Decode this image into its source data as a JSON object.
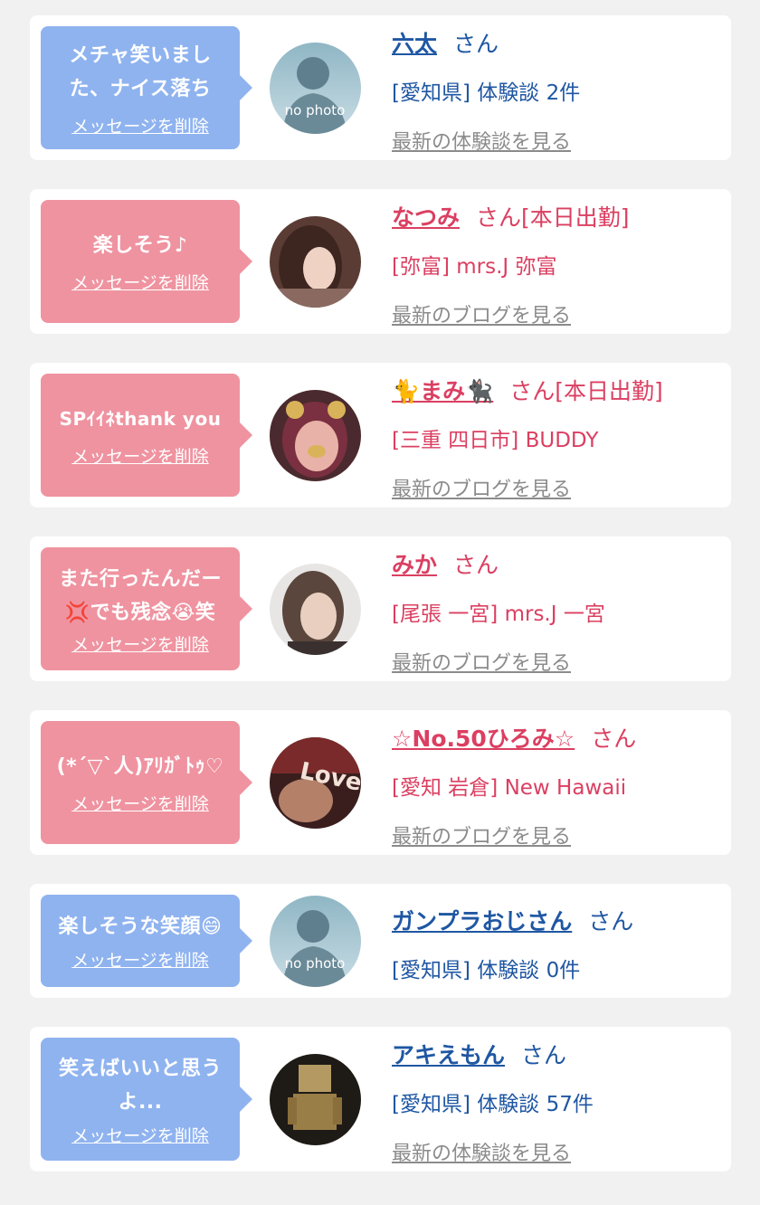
{
  "delete_label": "メッセージを削除",
  "colors": {
    "blue_bubble": "#8fb3ef",
    "pink_bubble": "#ef93a0",
    "blue_text": "#1f57a3",
    "pink_text": "#db3f61"
  },
  "items": [
    {
      "message": "メチャ笑いました、ナイス落ち",
      "name": "六太",
      "honorific": "さん",
      "location": "[愛知県]",
      "detail": "体験談 2件",
      "link": "最新の体験談を見る",
      "avatar": "no photo"
    },
    {
      "message": "楽しそう♪",
      "name": "なつみ",
      "honorific": "さん[本日出勤]",
      "location": "[弥富]",
      "detail": "mrs.J 弥富",
      "link": "最新のブログを見る"
    },
    {
      "message": "SPｲｲﾈthank you",
      "name": "🐈まみ🐈‍⬛",
      "honorific": "さん[本日出勤]",
      "location": "[三重 四日市]",
      "detail": "BUDDY",
      "link": "最新のブログを見る"
    },
    {
      "message": "また行ったんだー💢でも残念😭笑",
      "name": "みか",
      "honorific": "さん",
      "location": "[尾張 一宮]",
      "detail": "mrs.J 一宮",
      "link": "最新のブログを見る"
    },
    {
      "message": "(*´▽`人)ｱﾘｶﾞﾄｩ♡",
      "name": "☆No.50ひろみ☆",
      "honorific": "さん",
      "location": "[愛知 岩倉]",
      "detail": "New Hawaii",
      "link": "最新のブログを見る",
      "avatar_text": "Love"
    },
    {
      "message": "楽しそうな笑顔😄",
      "name": "ガンプラおじさん",
      "honorific": "さん",
      "location": "[愛知県]",
      "detail": "体験談 0件",
      "avatar": "no photo"
    },
    {
      "message": "笑えばいいと思うよ...",
      "name": "アキえもん",
      "honorific": "さん",
      "location": "[愛知県]",
      "detail": "体験談 57件",
      "link": "最新の体験談を見る"
    }
  ]
}
